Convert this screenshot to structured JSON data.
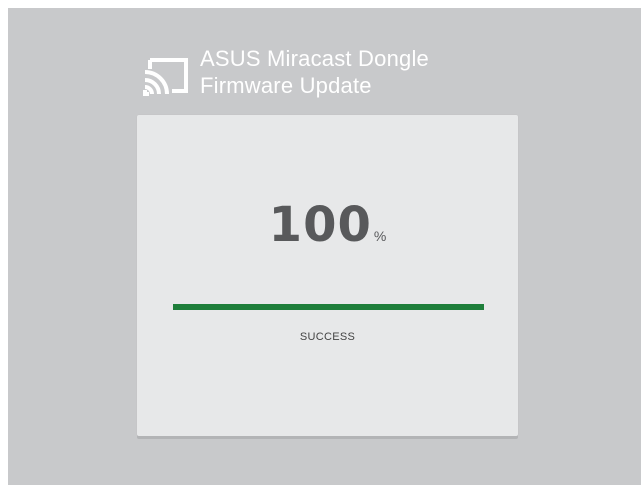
{
  "header": {
    "icon": "cast-icon",
    "title_line_1": "ASUS Miracast Dongle",
    "title_line_2": "Firmware Update"
  },
  "progress": {
    "percent_value": "100",
    "percent_unit": "%",
    "fraction": 1.0,
    "status": "SUCCESS"
  },
  "colors": {
    "background": "#c8c9cb",
    "card": "#e7e8e9",
    "progress_fill": "#1e7e3a",
    "percent_text": "#58595b"
  }
}
